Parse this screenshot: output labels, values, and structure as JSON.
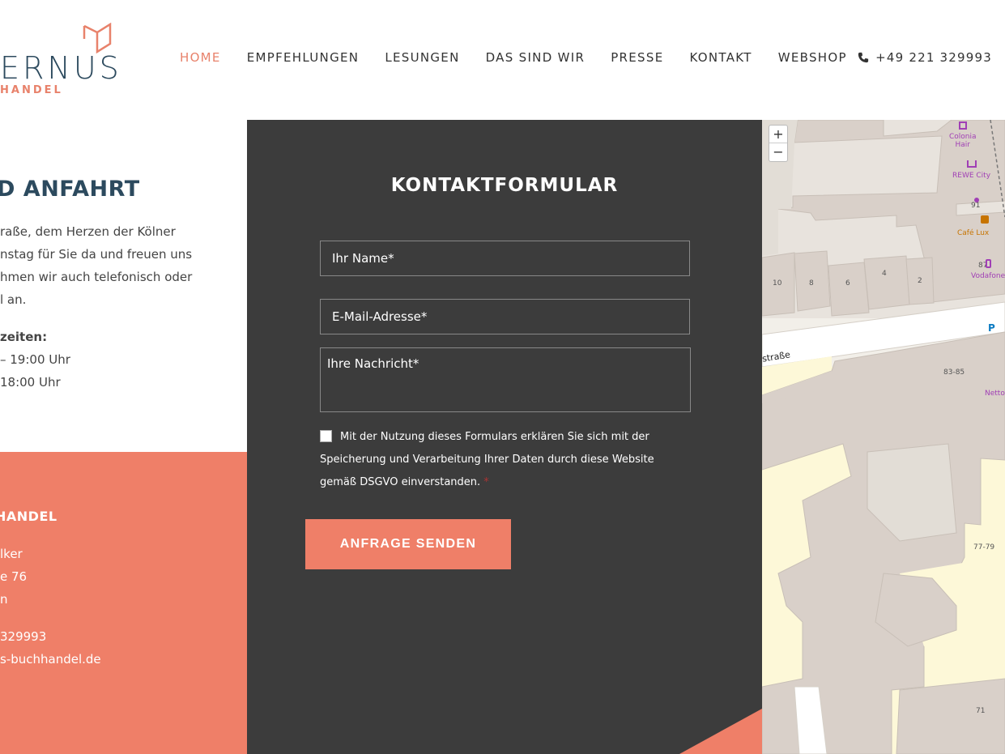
{
  "header": {
    "logo_main": "ERNUS",
    "logo_sub": "HANDEL",
    "nav": [
      {
        "label": "HOME",
        "active": true
      },
      {
        "label": "EMPFEHLUNGEN",
        "active": false
      },
      {
        "label": "LESUNGEN",
        "active": false
      },
      {
        "label": "DAS SIND WIR",
        "active": false
      },
      {
        "label": "PRESSE",
        "active": false
      },
      {
        "label": "KONTAKT",
        "active": false
      },
      {
        "label": "WEBSHOP",
        "active": false
      }
    ],
    "phone": "+49 221 329993",
    "phone_icon": "phone-icon"
  },
  "left": {
    "title": "D ANFAHRT",
    "text_lines": [
      "raße, dem Herzen der Kölner",
      "nstag für Sie da und freuen uns",
      "hmen wir auch telefonisch oder",
      "l an."
    ],
    "hours_label": "zeiten:",
    "hours_lines": [
      "– 19:00 Uhr",
      "18:00 Uhr"
    ]
  },
  "left_bottom": {
    "title": "HANDEL",
    "address_lines": [
      "lker",
      "e 76",
      "n"
    ],
    "contact_lines": [
      "329993",
      "s-buchhandel.de"
    ]
  },
  "form": {
    "title": "KONTAKTFORMULAR",
    "name_placeholder": "Ihr Name*",
    "email_placeholder": "E-Mail-Adresse*",
    "message_placeholder": "Ihre Nachricht*",
    "consent_text": "Mit der Nutzung dieses Formulars erklären Sie sich mit der Speicherung und Verarbeitung Ihrer Daten durch diese Website gemäß DSGVO einverstanden.",
    "consent_required": "*",
    "submit_label": "ANFRAGE SENDEN"
  },
  "map": {
    "zoom_in": "+",
    "zoom_out": "−",
    "labels": {
      "colonia": "Colonia",
      "hair": "Hair",
      "rewe": "REWE City",
      "n91": "91",
      "cafe": "Café Lux",
      "n87": "87",
      "vodafone": "Vodafone",
      "n10": "10",
      "n8": "8",
      "n6": "6",
      "n4": "4",
      "n2": "2",
      "street": "straße",
      "n8385": "83-85",
      "netto": "Netto",
      "n7779": "77-79",
      "n71": "71"
    },
    "colors": {
      "land": "#f2efe9",
      "building": "#d9d0c9",
      "road": "#ffffff",
      "yard": "#fdf8d8",
      "poi": "#a03fb5"
    }
  },
  "colors": {
    "accent": "#ef7f68",
    "dark": "#3c3c3c",
    "navy": "#2c4a5e"
  }
}
